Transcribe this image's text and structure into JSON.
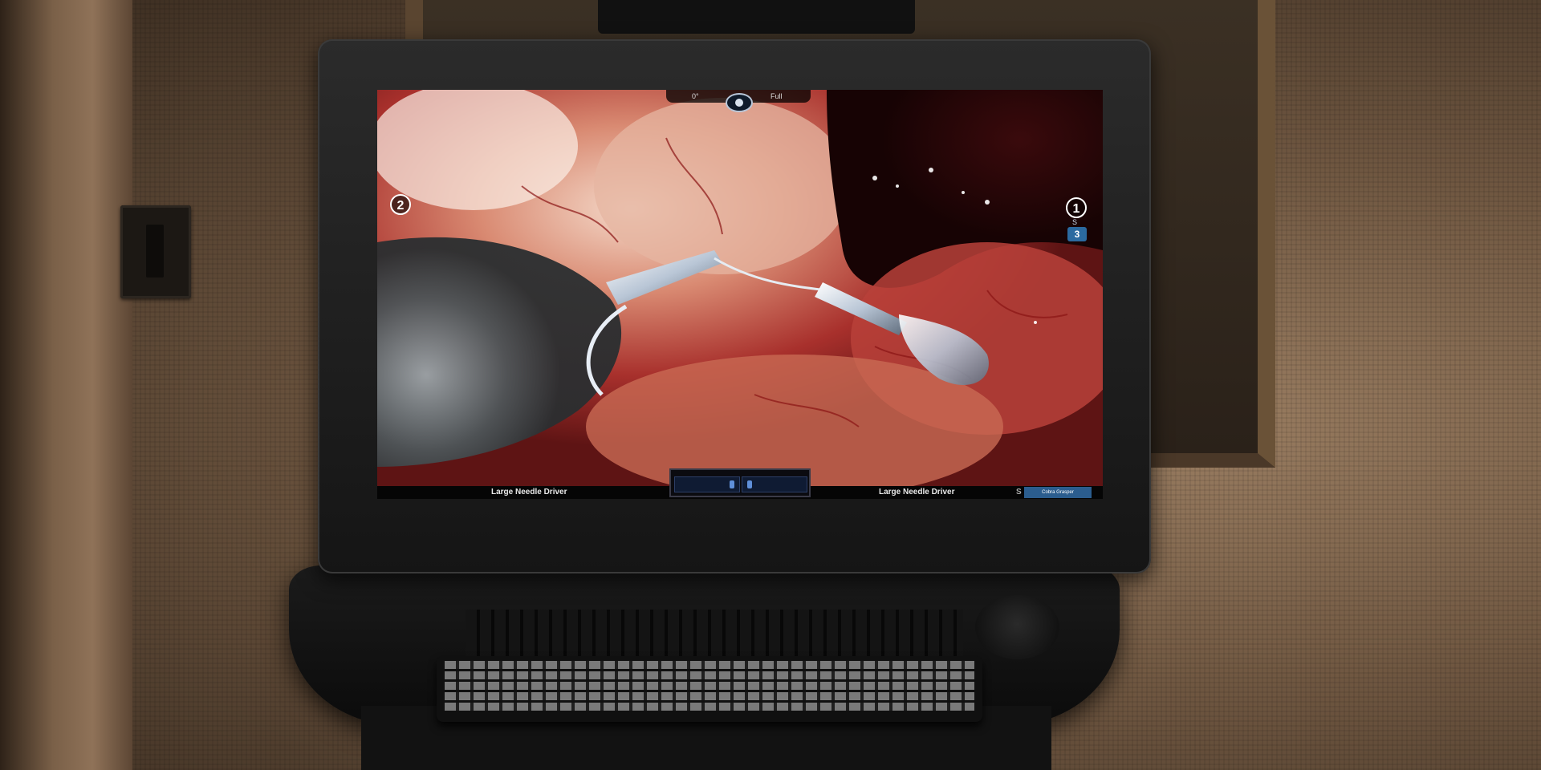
{
  "scene": "surgical video monitor",
  "hud": {
    "camera_angle": "0°",
    "zoom_mode": "Full",
    "arm_left_number": "2",
    "arm_right_number": "1",
    "arm_third_number": "3",
    "arm_third_letter": "S"
  },
  "status_bar": {
    "left_instrument": "Large Needle Driver",
    "right_instrument": "Large Needle Driver",
    "third_prefix": "S",
    "third_instrument": "Cobra Grasper"
  },
  "colors": {
    "status_accent": "#2b5d8e",
    "tissue": "#a8302c",
    "instrument": "#d8dde6"
  }
}
